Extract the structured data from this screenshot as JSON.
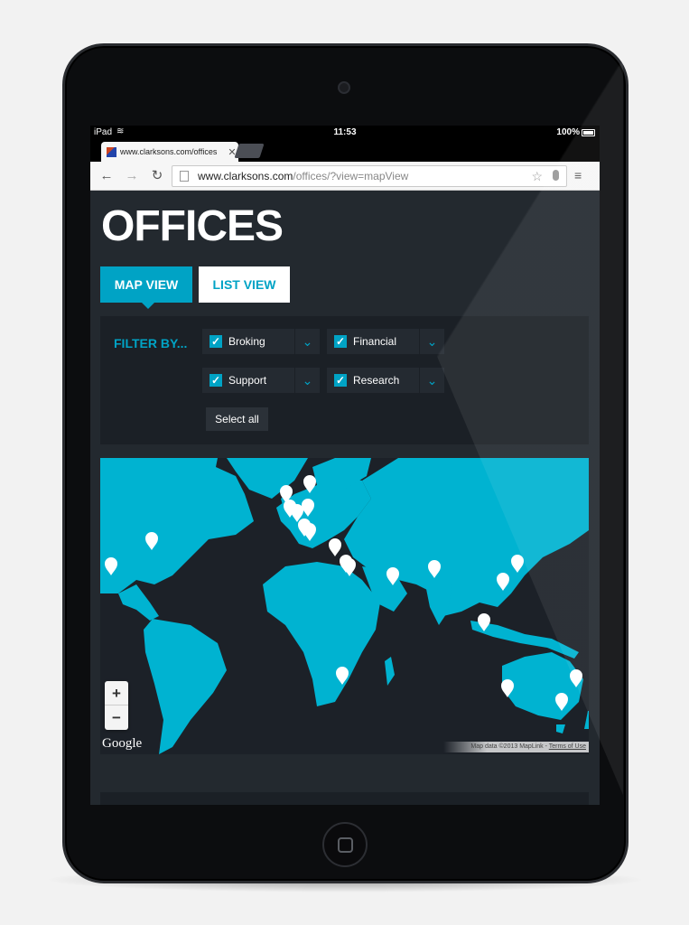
{
  "status_bar": {
    "carrier": "iPad",
    "time": "11:53",
    "battery": "100%"
  },
  "browser": {
    "tab_title": "www.clarksons.com/offices",
    "url_host": "www.clarksons.com",
    "url_path": "/offices/?view=mapView"
  },
  "page": {
    "title": "OFFICES",
    "map_view_label": "MAP VIEW",
    "list_view_label": "LIST VIEW"
  },
  "filter": {
    "label": "FILTER BY...",
    "options": [
      {
        "name": "Broking",
        "checked": true
      },
      {
        "name": "Financial",
        "checked": true
      },
      {
        "name": "Support",
        "checked": true
      },
      {
        "name": "Research",
        "checked": true
      }
    ],
    "select_all": "Select all"
  },
  "map": {
    "zoom_in": "+",
    "zoom_out": "−",
    "provider": "Google",
    "attribution": "Map data ©2013 MapLink -",
    "terms": "Terms of Use",
    "land_color": "#00b3d1",
    "sea_color": "#1c2128",
    "marker_color": "#ffffff"
  },
  "colors": {
    "accent": "#00a3c5",
    "page_bg": "#23292f",
    "panel_bg": "#1b2026"
  }
}
